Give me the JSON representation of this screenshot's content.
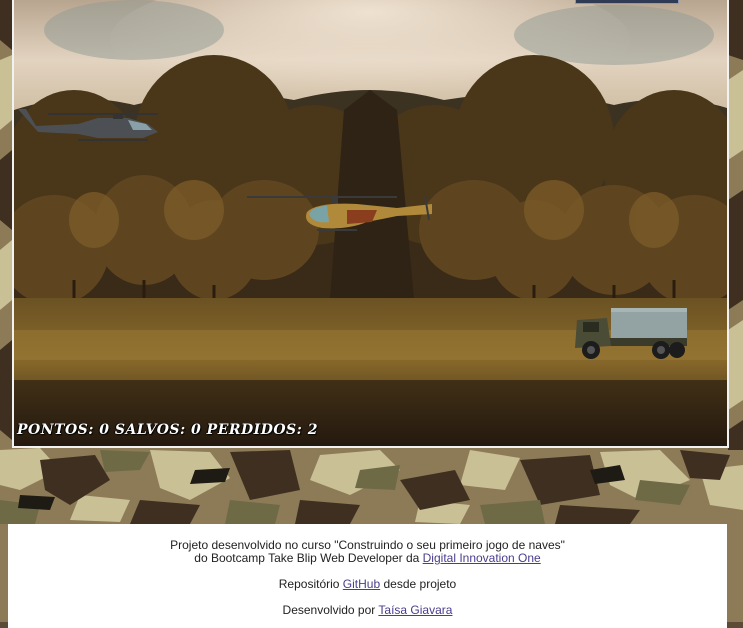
{
  "hud": {
    "pontos_label": "PONTOS:",
    "pontos_value": "0",
    "salvos_label": "SALVOS:",
    "salvos_value": "0",
    "perdidos_label": "PERDIDOS:",
    "perdidos_value": "2"
  },
  "sprites": {
    "enemy_helicopter": "enemy-helicopter",
    "player_helicopter": "player-helicopter",
    "truck": "ally-truck"
  },
  "footer": {
    "line1": "Projeto desenvolvido no curso \"Construindo o seu primeiro jogo de naves\"",
    "line2_prefix": "do Bootcamp Take Blip Web Developer da",
    "line2_link": "Digital Innovation One",
    "line3_prefix": "Repositório",
    "line3_link": "GitHub",
    "line3_suffix": "desde projeto",
    "line4_prefix": "Desenvolvido por",
    "line4_link": "Taísa Giavara"
  },
  "colors": {
    "camo_light": "#c9c096",
    "camo_mid": "#8d7b57",
    "camo_dark": "#3f2f20",
    "camo_green": "#6e6a46",
    "link": "#4b3c8c"
  }
}
